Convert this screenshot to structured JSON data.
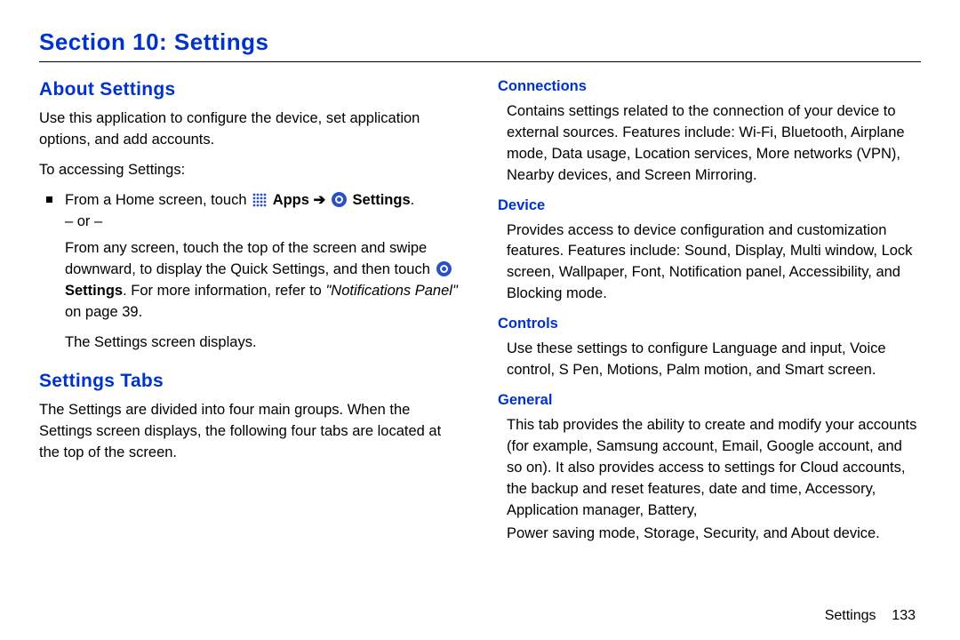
{
  "section_title": "Section 10: Settings",
  "left": {
    "about_h": "About Settings",
    "about_p": "Use this application to configure the device, set application options, and add accounts.",
    "to_access": "To accessing Settings:",
    "from_home_pre": "From a Home screen, touch",
    "apps_label": "Apps",
    "settings_label": "Settings",
    "period": ".",
    "or": "– or –",
    "from_any_pre": "From any screen, touch the top of the screen and swipe downward, to display the Quick Settings, and then touch",
    "from_any_post": ". For more information, refer to",
    "ref_italic": "\"Notifications Panel\"",
    "ref_tail": " on page 39.",
    "displays": "The Settings screen displays.",
    "tabs_h": "Settings Tabs",
    "tabs_p": "The Settings are divided into four main groups. When the Settings screen displays, the following four tabs are located at the top of the screen."
  },
  "right": {
    "conn_h": "Connections",
    "conn_p": "Contains settings related to the connection of your device to external sources. Features include: Wi-Fi, Bluetooth, Airplane mode, Data usage, Location services, More networks (VPN), Nearby devices, and Screen Mirroring.",
    "dev_h": "Device",
    "dev_p": "Provides access to device configuration and customization features. Features include: Sound, Display, Multi window, Lock screen, Wallpaper, Font, Notification panel, Accessibility, and Blocking mode.",
    "ctrl_h": "Controls",
    "ctrl_p": "Use these settings to configure Language and input, Voice control, S Pen, Motions, Palm motion, and Smart screen.",
    "gen_h": "General",
    "gen_p1": "This tab provides the ability to create and modify your accounts (for example, Samsung account, Email, Google account, and so on). It also provides access to settings for Cloud accounts, the backup and reset features, date and time, Accessory, Application manager, Battery,",
    "gen_p2": "Power saving mode, Storage, Security, and About device."
  },
  "footer": {
    "label": "Settings",
    "page": "133"
  }
}
